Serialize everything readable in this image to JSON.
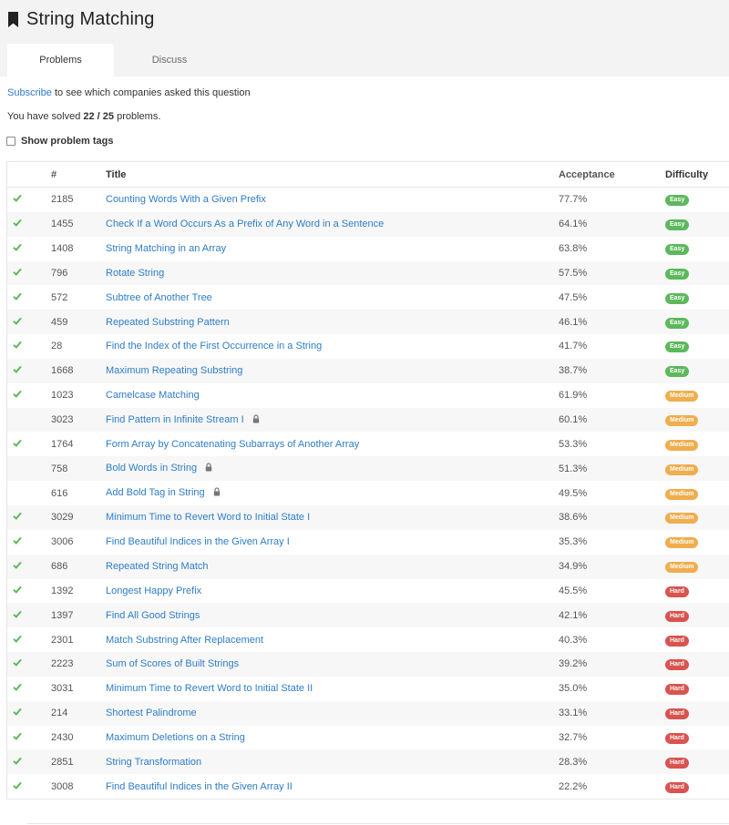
{
  "page": {
    "title": "String Matching",
    "tabs": [
      {
        "label": "Problems",
        "active": true
      },
      {
        "label": "Discuss",
        "active": false
      }
    ],
    "subscribe_link": "Subscribe",
    "subscribe_rest": "to see which companies asked this question",
    "solved_prefix": "You have solved",
    "solved_count": "22 / 25",
    "solved_suffix": "problems.",
    "show_tags_label": "Show problem tags"
  },
  "colors": {
    "link": "#2e7cc6",
    "check": "#5cb85c",
    "easy": "#5cb85c",
    "medium": "#f0ad4e",
    "hard": "#d9534f"
  },
  "table": {
    "headers": [
      "#",
      "Title",
      "Acceptance",
      "Difficulty"
    ],
    "rows": [
      {
        "solved": true,
        "num": "2185",
        "title": "Counting Words With a Given Prefix",
        "locked": false,
        "acceptance": "77.7%",
        "difficulty": "Easy"
      },
      {
        "solved": true,
        "num": "1455",
        "title": "Check If a Word Occurs As a Prefix of Any Word in a Sentence",
        "locked": false,
        "acceptance": "64.1%",
        "difficulty": "Easy"
      },
      {
        "solved": true,
        "num": "1408",
        "title": "String Matching in an Array",
        "locked": false,
        "acceptance": "63.8%",
        "difficulty": "Easy"
      },
      {
        "solved": true,
        "num": "796",
        "title": "Rotate String",
        "locked": false,
        "acceptance": "57.5%",
        "difficulty": "Easy"
      },
      {
        "solved": true,
        "num": "572",
        "title": "Subtree of Another Tree",
        "locked": false,
        "acceptance": "47.5%",
        "difficulty": "Easy"
      },
      {
        "solved": true,
        "num": "459",
        "title": "Repeated Substring Pattern",
        "locked": false,
        "acceptance": "46.1%",
        "difficulty": "Easy"
      },
      {
        "solved": true,
        "num": "28",
        "title": "Find the Index of the First Occurrence in a String",
        "locked": false,
        "acceptance": "41.7%",
        "difficulty": "Easy"
      },
      {
        "solved": true,
        "num": "1668",
        "title": "Maximum Repeating Substring",
        "locked": false,
        "acceptance": "38.7%",
        "difficulty": "Easy"
      },
      {
        "solved": true,
        "num": "1023",
        "title": "Camelcase Matching",
        "locked": false,
        "acceptance": "61.9%",
        "difficulty": "Medium"
      },
      {
        "solved": false,
        "num": "3023",
        "title": "Find Pattern in Infinite Stream I",
        "locked": true,
        "acceptance": "60.1%",
        "difficulty": "Medium"
      },
      {
        "solved": true,
        "num": "1764",
        "title": "Form Array by Concatenating Subarrays of Another Array",
        "locked": false,
        "acceptance": "53.3%",
        "difficulty": "Medium"
      },
      {
        "solved": false,
        "num": "758",
        "title": "Bold Words in String",
        "locked": true,
        "acceptance": "51.3%",
        "difficulty": "Medium"
      },
      {
        "solved": false,
        "num": "616",
        "title": "Add Bold Tag in String",
        "locked": true,
        "acceptance": "49.5%",
        "difficulty": "Medium"
      },
      {
        "solved": true,
        "num": "3029",
        "title": "Minimum Time to Revert Word to Initial State I",
        "locked": false,
        "acceptance": "38.6%",
        "difficulty": "Medium"
      },
      {
        "solved": true,
        "num": "3006",
        "title": "Find Beautiful Indices in the Given Array I",
        "locked": false,
        "acceptance": "35.3%",
        "difficulty": "Medium"
      },
      {
        "solved": true,
        "num": "686",
        "title": "Repeated String Match",
        "locked": false,
        "acceptance": "34.9%",
        "difficulty": "Medium"
      },
      {
        "solved": true,
        "num": "1392",
        "title": "Longest Happy Prefix",
        "locked": false,
        "acceptance": "45.5%",
        "difficulty": "Hard"
      },
      {
        "solved": true,
        "num": "1397",
        "title": "Find All Good Strings",
        "locked": false,
        "acceptance": "42.1%",
        "difficulty": "Hard"
      },
      {
        "solved": true,
        "num": "2301",
        "title": "Match Substring After Replacement",
        "locked": false,
        "acceptance": "40.3%",
        "difficulty": "Hard"
      },
      {
        "solved": true,
        "num": "2223",
        "title": "Sum of Scores of Built Strings",
        "locked": false,
        "acceptance": "39.2%",
        "difficulty": "Hard"
      },
      {
        "solved": true,
        "num": "3031",
        "title": "Minimum Time to Revert Word to Initial State II",
        "locked": false,
        "acceptance": "35.0%",
        "difficulty": "Hard"
      },
      {
        "solved": true,
        "num": "214",
        "title": "Shortest Palindrome",
        "locked": false,
        "acceptance": "33.1%",
        "difficulty": "Hard"
      },
      {
        "solved": true,
        "num": "2430",
        "title": "Maximum Deletions on a String",
        "locked": false,
        "acceptance": "32.7%",
        "difficulty": "Hard"
      },
      {
        "solved": true,
        "num": "2851",
        "title": "String Transformation",
        "locked": false,
        "acceptance": "28.3%",
        "difficulty": "Hard"
      },
      {
        "solved": true,
        "num": "3008",
        "title": "Find Beautiful Indices in the Given Array II",
        "locked": false,
        "acceptance": "22.2%",
        "difficulty": "Hard"
      }
    ]
  }
}
